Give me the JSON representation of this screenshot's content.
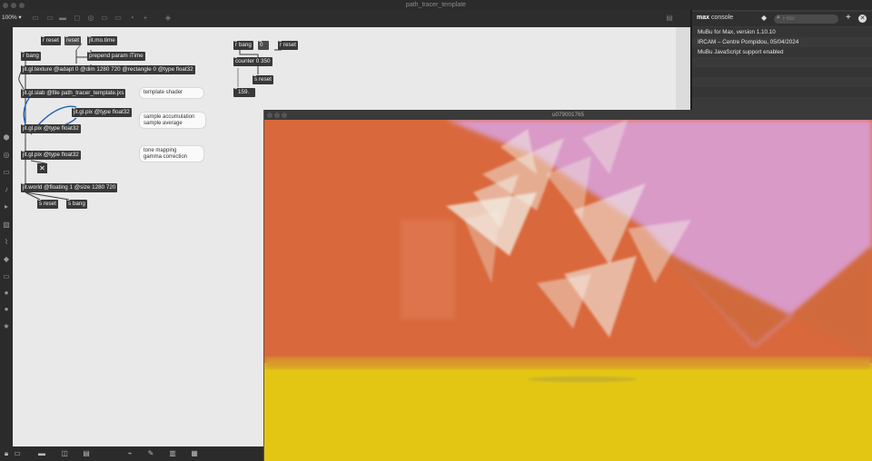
{
  "window": {
    "title": "path_tracer_template"
  },
  "toolbar": {
    "zoom": "100%"
  },
  "patcher": {
    "objects": {
      "r_reset_1": "r reset",
      "reset_msg": "reset",
      "jit_mo_time": "jit.mo.time",
      "r_bang_1": "r bang",
      "prepend": "prepend param iTime",
      "jit_gl_texture": "jit.gl.texture @adapt 0 @dim 1280 720 @rectangle 0 @type float32",
      "jit_gl_slab": "jit.gl.slab @file path_tracer_template.jxs",
      "jit_gl_pix_1": "jit.gl.pix @type float32",
      "jit_gl_pix_2": "jit.gl.pix @type float32",
      "jit_gl_pix_3": "jit.gl.pix @type float32",
      "jit_world": "jit.world @floating 1 @size 1280 720",
      "s_reset_1": "s reset",
      "s_bang": "s bang",
      "r_bang_2": "r bang",
      "zero_msg": "0",
      "r_reset_2": "r reset",
      "counter": "counter 0 350",
      "s_reset_2": "s reset",
      "number_box": "159."
    },
    "comments": {
      "template_shader": "template shader",
      "accum_line1": "sample accumulation",
      "accum_line2": "sample average",
      "tone_line1": "tone mapping",
      "tone_line2": "gamma correction"
    }
  },
  "console": {
    "title_bold": "max",
    "title_rest": " console",
    "filter_placeholder": "Filter",
    "lines": [
      "MuBu for Max, version 1.10.10",
      "   IRCAM – Centre Pompidou, 05/04/2024",
      "MuBu JavaScript support enabled"
    ]
  },
  "render_window": {
    "title": "u079001765"
  },
  "colors": {
    "scene_orange": "#d9683c",
    "scene_pink": "#d99ac8",
    "scene_yellow": "#e3c614",
    "patch_bg": "#e9e9e9",
    "object_bg": "#383838"
  }
}
